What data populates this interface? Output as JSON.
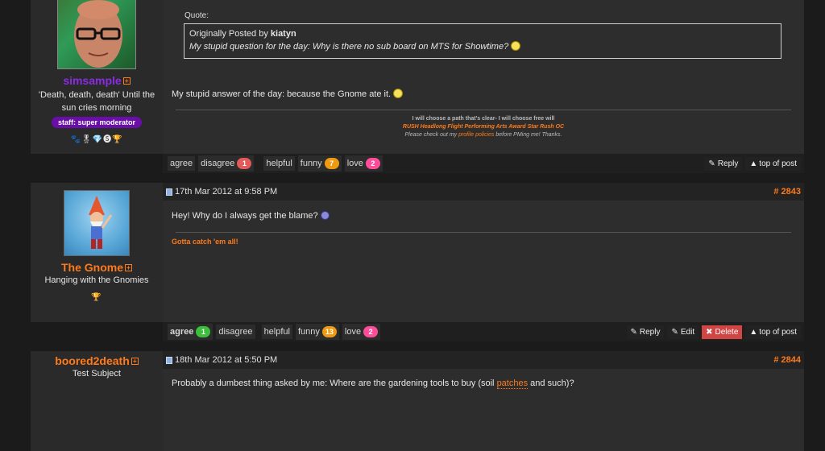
{
  "posts": [
    {
      "user": {
        "name": "simsample",
        "name_color": "#8a2be2",
        "plus": "+",
        "title": "'Death, death, death' Until the sun cries morning",
        "staff_badge": "staff: super moderator",
        "awards": "🐾🎖💎🅢🏆"
      },
      "quote": {
        "label": "Quote:",
        "originally_posted_by": "Originally Posted by",
        "author": "kiatyn",
        "text": "My stupid question for the day: Why is there no sub board on MTS for Showtime?"
      },
      "body": "My stupid answer of the day: because the Gnome ate it.",
      "signature": {
        "line1": "I will choose a path that's clear- I will choose free will",
        "line2": "RUSH Headlong Flight Performing Arts Award Star Rush OC",
        "line3_pre": "Please check out my",
        "line3_link": "profile policies",
        "line3_post": "before PMing me! Thanks."
      },
      "reactions": [
        {
          "label": "agree",
          "count": null
        },
        {
          "label": "disagree",
          "count": "1",
          "color": "red"
        },
        {
          "label": "helpful",
          "count": null
        },
        {
          "label": "funny",
          "count": "7",
          "color": "orange"
        },
        {
          "label": "love",
          "count": "2",
          "color": "pink"
        }
      ],
      "actions": {
        "reply": "Reply",
        "top": "top of post"
      }
    },
    {
      "date": "17th Mar 2012 at 9:58 PM",
      "number": "# 2843",
      "user": {
        "name": "The Gnome",
        "name_color": "#ff7a1a",
        "plus": "+",
        "title": "Hanging with the Gnomies",
        "awards": "🏆"
      },
      "body": "Hey! Why do I always get the blame?",
      "signature": "Gotta catch 'em all!",
      "reactions": [
        {
          "label": "agree",
          "count": "1",
          "color": "green",
          "bold": true
        },
        {
          "label": "disagree",
          "count": null
        },
        {
          "label": "helpful",
          "count": null
        },
        {
          "label": "funny",
          "count": "13",
          "color": "orange"
        },
        {
          "label": "love",
          "count": "2",
          "color": "pink"
        }
      ],
      "actions": {
        "reply": "Reply",
        "edit": "Edit",
        "delete": "Delete",
        "top": "top of post"
      }
    },
    {
      "date": "18th Mar 2012 at 5:50 PM",
      "number": "# 2844",
      "user": {
        "name": "boored2death",
        "name_color": "#ff7a1a",
        "plus": "+",
        "title": "Test Subject"
      },
      "body_pre": "Probably a dumbest thing asked by me: Where are the gardening tools to buy (soil ",
      "body_link": "patches",
      "body_post": " and such)?"
    }
  ]
}
